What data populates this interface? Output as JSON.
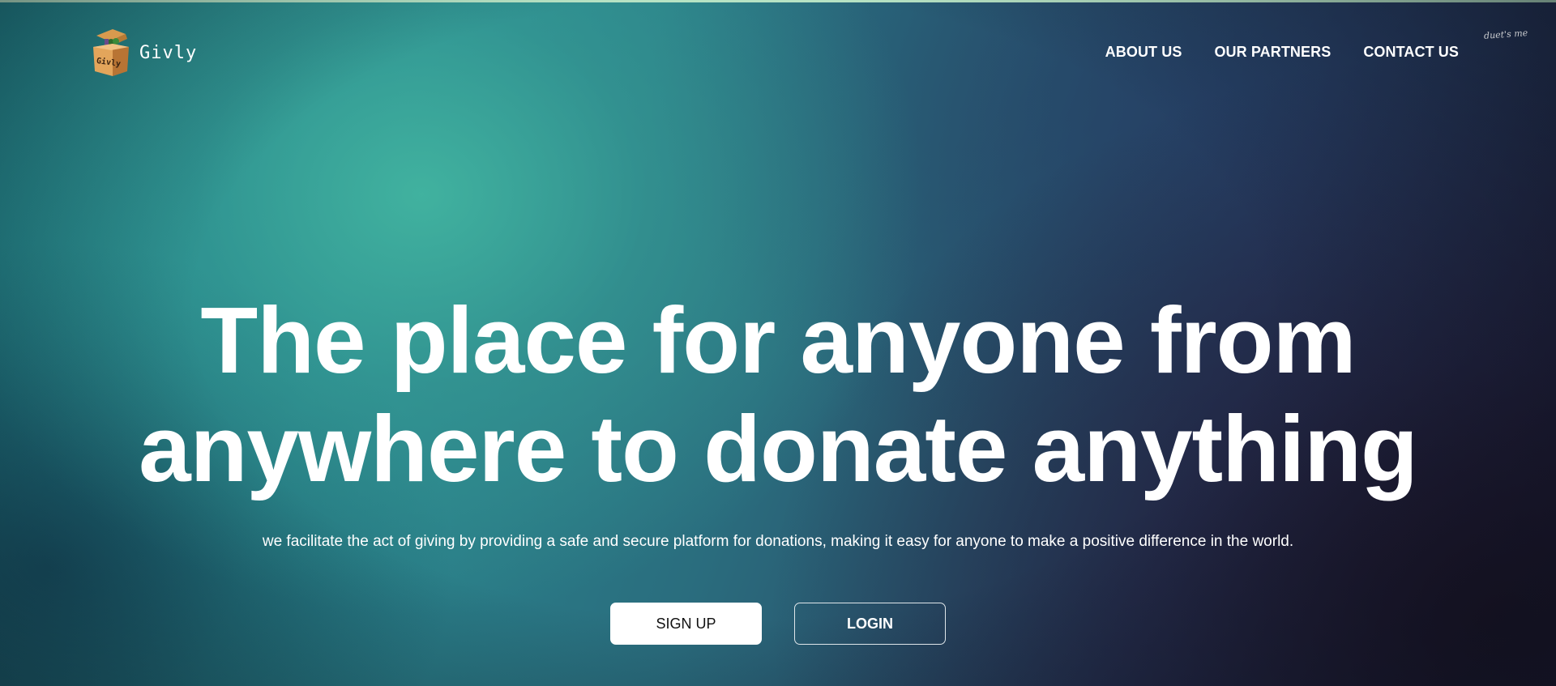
{
  "header": {
    "brand_name": "Givly",
    "logo_box_text": "Givly",
    "nav": [
      {
        "label": "ABOUT US"
      },
      {
        "label": "OUR PARTNERS"
      },
      {
        "label": "CONTACT US"
      }
    ],
    "corner_mark": "duet's me"
  },
  "hero": {
    "title_line1": "The place for anyone from",
    "title_line2": "anywhere to donate anything",
    "subtitle": "we facilitate the act of giving by providing a safe and secure platform for donations, making it easy for anyone to make a positive difference in the world.",
    "signup_label": "SIGN UP",
    "login_label": "LOGIN"
  },
  "colors": {
    "accent_top_line": "#b7e3c4",
    "text": "#ffffff",
    "signup_bg": "#ffffff"
  }
}
